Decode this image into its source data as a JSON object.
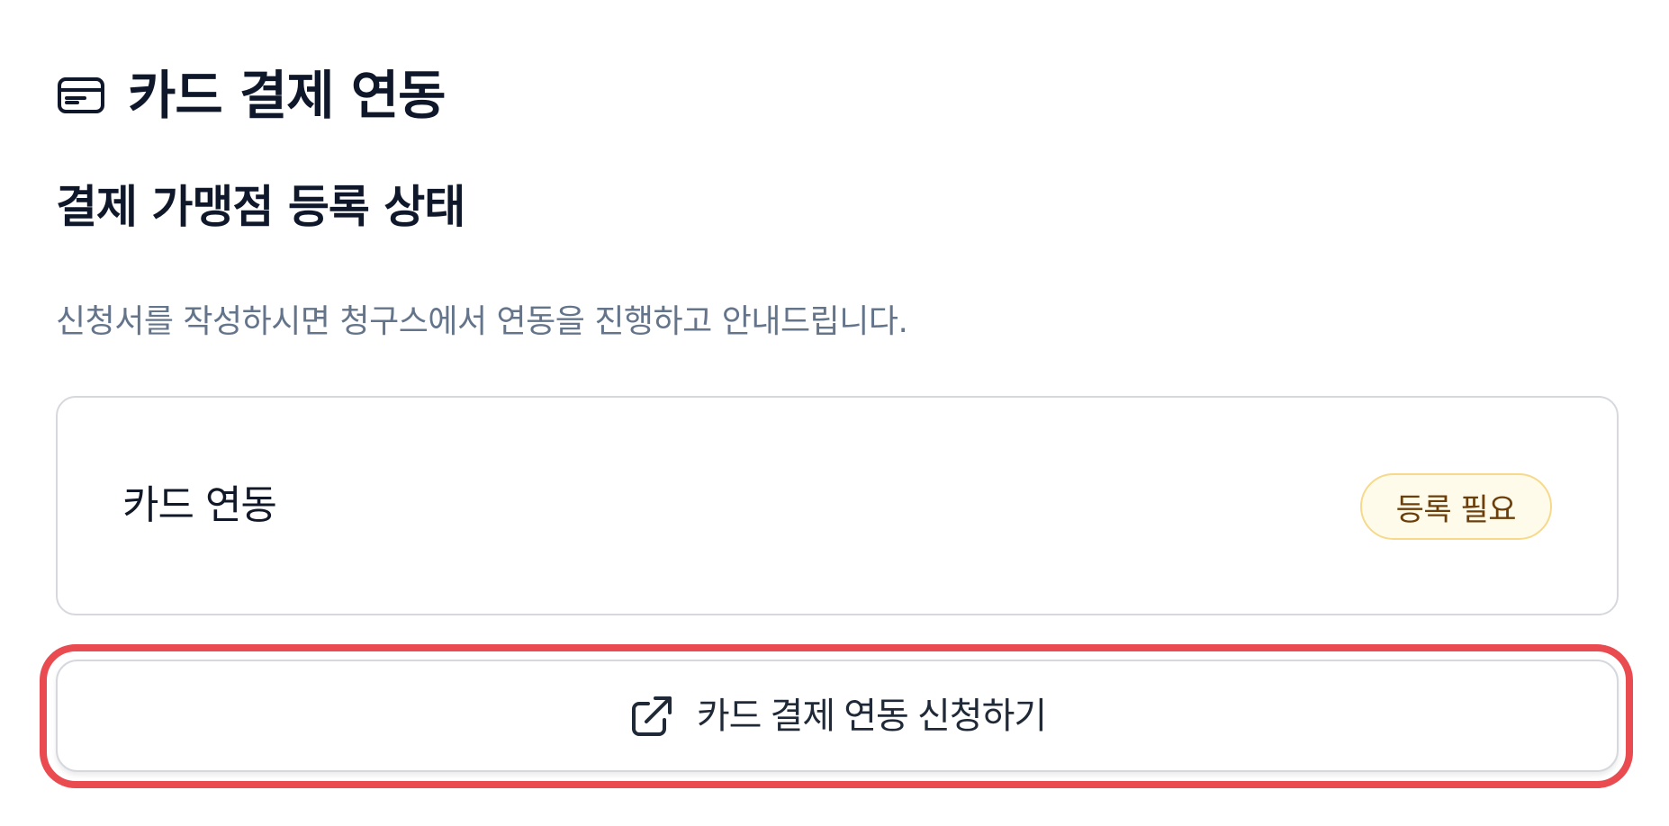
{
  "header": {
    "title": "카드 결제 연동",
    "icon": "credit-card-icon"
  },
  "section": {
    "title": "결제 가맹점 등록 상태",
    "description": "신청서를 작성하시면 청구스에서 연동을 진행하고 안내드립니다."
  },
  "status_card": {
    "label": "카드 연동",
    "badge": "등록 필요",
    "badge_color": "#fffbeb",
    "badge_border_color": "#f6d98b",
    "badge_text_color": "#6b3f0b"
  },
  "apply_button": {
    "label": "카드 결제 연동 신청하기",
    "icon": "external-link-icon"
  },
  "colors": {
    "title": "#0f172a",
    "description": "#64748b",
    "card_border": "#d6d8de",
    "highlight": "#ea4b50"
  }
}
